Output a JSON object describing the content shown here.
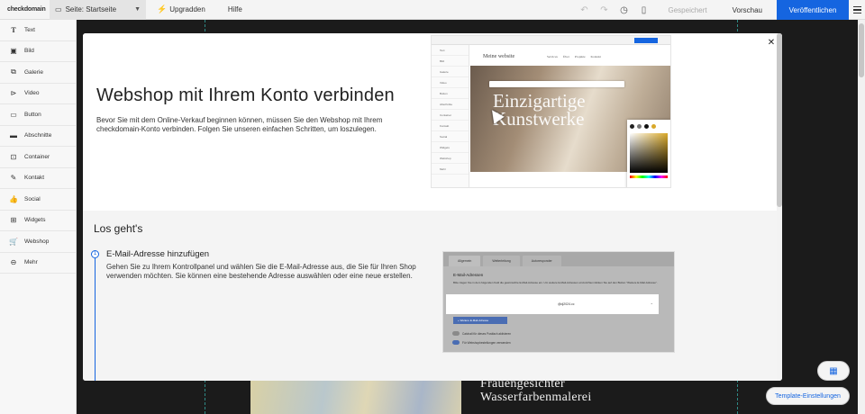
{
  "topbar": {
    "logo": "checkdomain",
    "page_label": "Seite: Startseite",
    "upgrade_label": "Upgradden",
    "help_label": "Hilfe",
    "saved_label": "Gespeichert",
    "preview_label": "Vorschau",
    "publish_label": "Veröffentlichen"
  },
  "sidebar": {
    "items": [
      {
        "label": "Text",
        "icon": "text-icon"
      },
      {
        "label": "Bild",
        "icon": "image-icon"
      },
      {
        "label": "Galerie",
        "icon": "gallery-icon"
      },
      {
        "label": "Video",
        "icon": "video-icon"
      },
      {
        "label": "Button",
        "icon": "button-icon"
      },
      {
        "label": "Abschnitte",
        "icon": "section-icon"
      },
      {
        "label": "Container",
        "icon": "container-icon"
      },
      {
        "label": "Kontakt",
        "icon": "contact-icon"
      },
      {
        "label": "Social",
        "icon": "social-icon"
      },
      {
        "label": "Widgets",
        "icon": "widgets-icon"
      },
      {
        "label": "Webshop",
        "icon": "cart-icon"
      },
      {
        "label": "Mehr",
        "icon": "more-icon"
      }
    ]
  },
  "modal": {
    "title": "Webshop mit Ihrem Konto verbinden",
    "intro": "Bevor Sie mit dem Online-Verkauf beginnen können, müssen Sie den Webshop mit Ihrem checkdomain-Konto verbinden. Folgen Sie unseren einfachen Schritten, um loszulegen.",
    "section_title": "Los geht's",
    "steps": [
      {
        "number": "1",
        "title": "E-Mail-Adresse hinzufügen",
        "text": "Gehen Sie zu Ihrem Kontrollpanel und wählen Sie die E-Mail-Adresse aus, die Sie für Ihren Shop verwenden möchten. Sie können eine bestehende Adresse auswählen oder eine neue erstellen."
      }
    ],
    "preview_shot": {
      "site_title": "Meine website",
      "nav": [
        "Services",
        "Über",
        "Projekte",
        "Kontakt"
      ],
      "headline_1": "Einzigartige",
      "headline_2": "Kunstwerke",
      "sidebar_items": [
        "Text",
        "Bild",
        "Galerie",
        "Video",
        "Button",
        "Abschnitte",
        "Container",
        "Kontakt",
        "Social",
        "Widgets",
        "Webshop",
        "Mehr"
      ]
    },
    "email_shot": {
      "tabs": [
        "Allgemein",
        "Weiterleitung",
        "Autoresponder"
      ],
      "title": "E-Mail-Adressen",
      "description": "Bitte tragen Sie in dem folgenden Feld die gewünschte E-Mail-Adresse ein. Um weitere E-Mail-Adressen einzurichten klicken Sie auf den Button \"Weitere E-Mail-Adresse\".",
      "address": "@dj2024.cc",
      "add_button": "+ Weitere E-Mail-Adresse",
      "toggle_1": "Catchall für dieses Postfach aktivieren",
      "toggle_2": "Für Webshopbestellungen verwenden"
    }
  },
  "canvas": {
    "art_caption_1": "Frauengesichter",
    "art_caption_2": "Wasserfarbenmalerei"
  },
  "floating": {
    "template_settings_label": "Template-Einstellungen"
  }
}
